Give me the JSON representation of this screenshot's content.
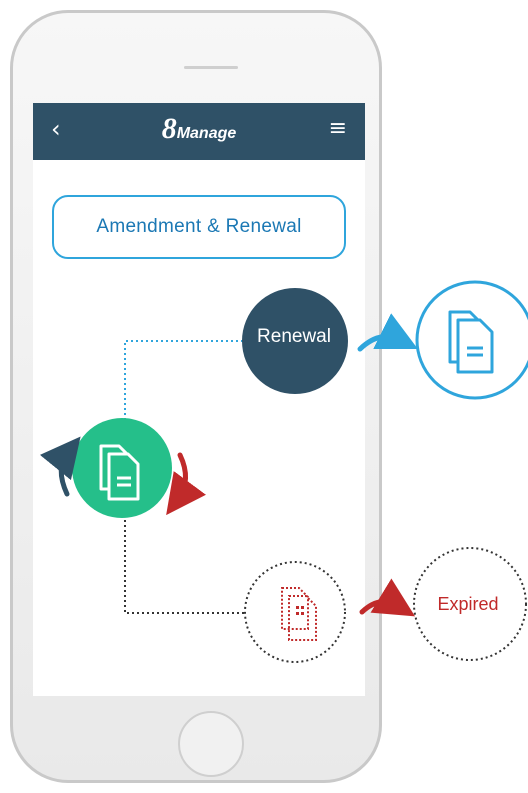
{
  "header": {
    "back_icon": "‹",
    "logo_number": "8",
    "logo_text": "Manage",
    "menu_icon": "≡"
  },
  "title_button": "Amendment & Renewal",
  "nodes": {
    "renewal": "Renewal",
    "expired": "Expired"
  },
  "colors": {
    "header": "#2f5167",
    "accent_blue": "#2fa5dc",
    "current_green": "#25bf8a",
    "renewal_dark": "#2f5167",
    "expired_red": "#c02a2a"
  },
  "icons": [
    "back-icon",
    "menu-icon",
    "document-icon",
    "cycle-arrows-icon",
    "arrow-right-icon"
  ]
}
